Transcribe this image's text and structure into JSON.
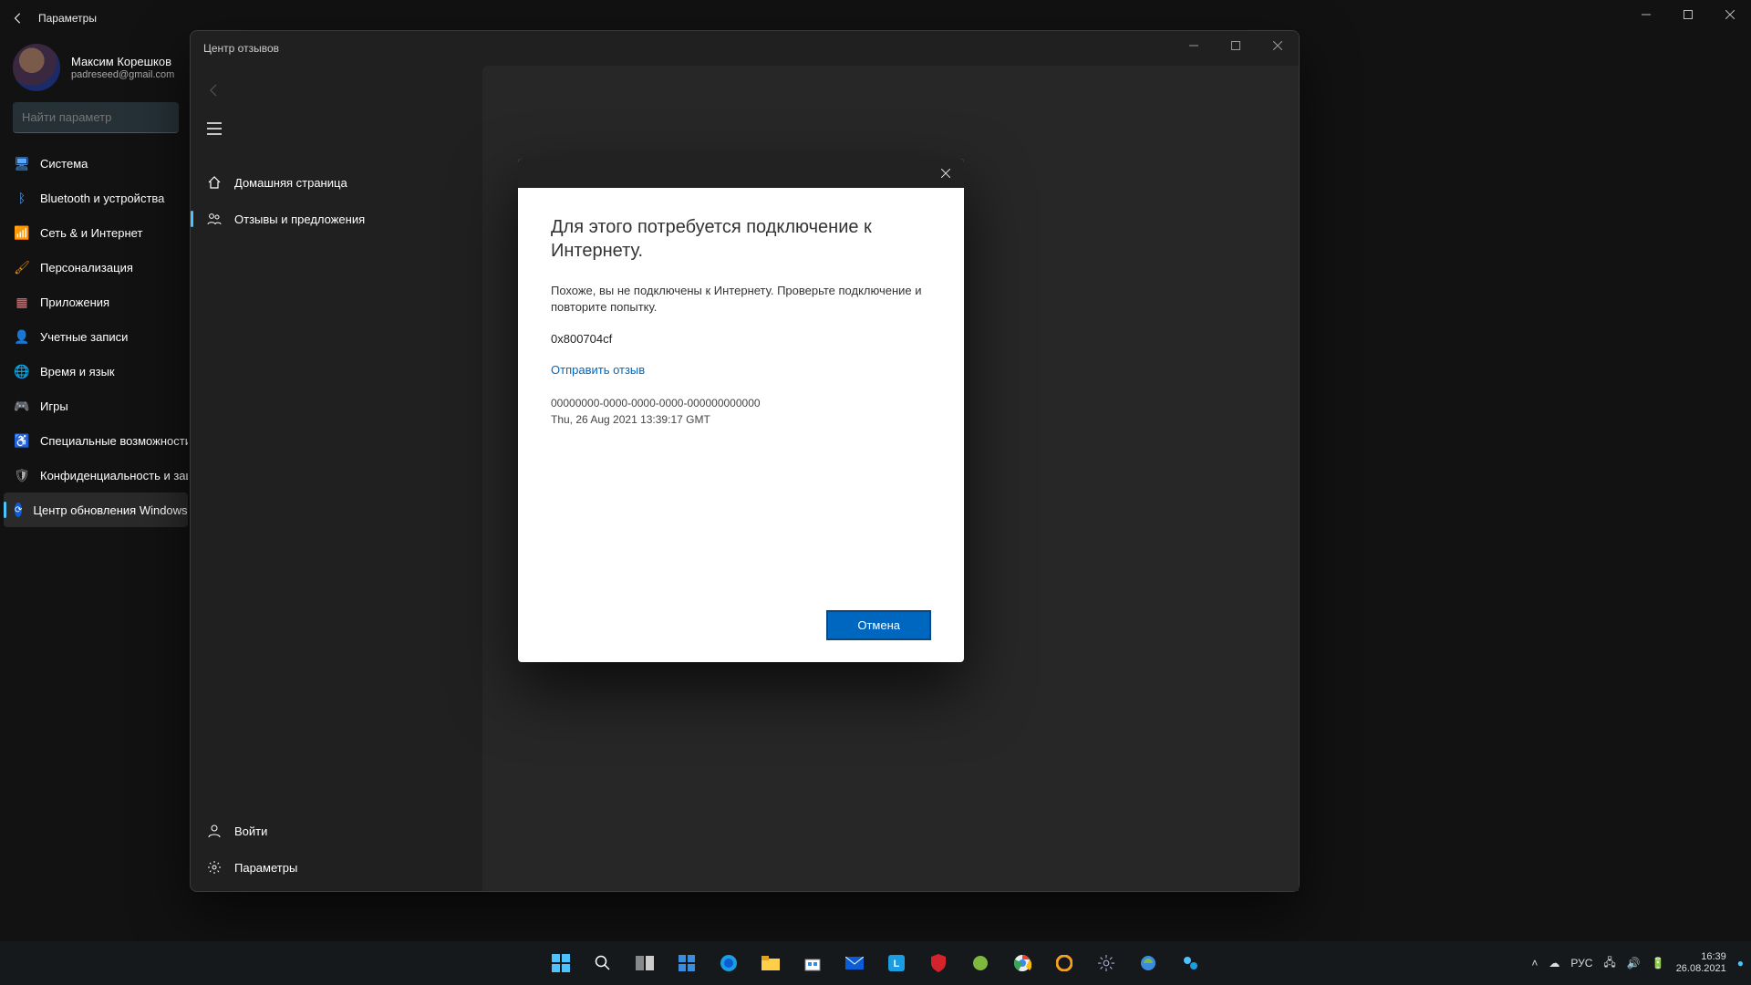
{
  "settings": {
    "title": "Параметры",
    "user": {
      "name": "Максим Корешков",
      "email": "padreseed@gmail.com"
    },
    "search_placeholder": "Найти параметр",
    "nav": [
      {
        "label": "Система"
      },
      {
        "label": "Bluetooth и устройства"
      },
      {
        "label": "Сеть & и Интернет"
      },
      {
        "label": "Персонализация"
      },
      {
        "label": "Приложения"
      },
      {
        "label": "Учетные записи"
      },
      {
        "label": "Время и язык"
      },
      {
        "label": "Игры"
      },
      {
        "label": "Специальные возможности"
      },
      {
        "label": "Конфиденциальность и защита"
      },
      {
        "label": "Центр обновления Windows"
      }
    ]
  },
  "feedback_hub": {
    "title": "Центр отзывов",
    "nav": {
      "home": "Домашняя страница",
      "feedback": "Отзывы и предложения",
      "signin": "Войти",
      "settings": "Параметры"
    }
  },
  "modal": {
    "heading": "Для этого потребуется подключение к Интернету.",
    "body": "Похоже, вы не подключены к Интернету. Проверьте подключение и повторите попытку.",
    "error_code": "0x800704cf",
    "link": "Отправить отзыв",
    "correlation": "00000000-0000-0000-0000-000000000000",
    "timestamp": "Thu, 26 Aug 2021 13:39:17 GMT",
    "cancel": "Отмена"
  },
  "taskbar": {
    "lang": "РУС",
    "time": "16:39",
    "date": "26.08.2021"
  }
}
